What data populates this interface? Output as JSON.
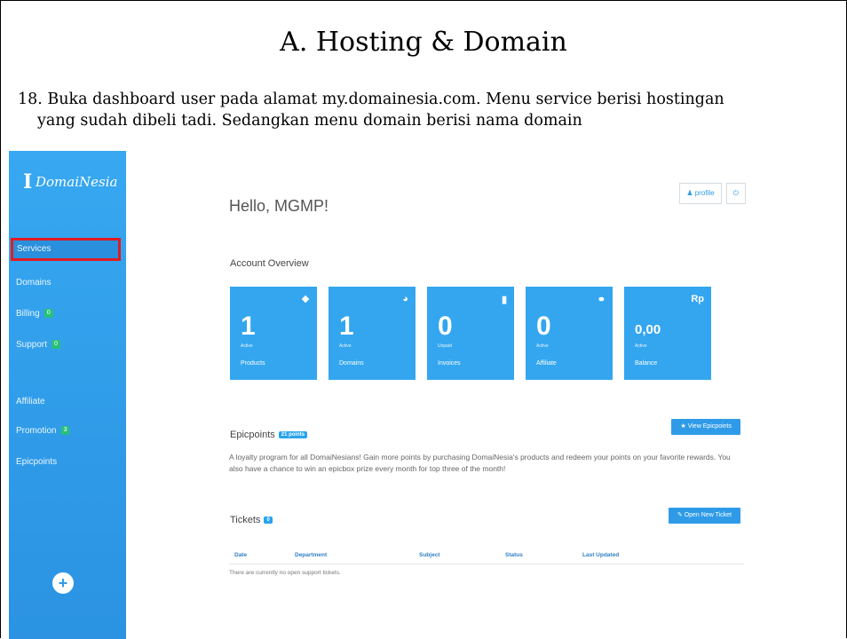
{
  "slide": {
    "title": "A. Hosting & Domain",
    "paragraph_line1": "18. Buka dashboard user pada alamat my.domainesia.com. Menu service berisi hostingan",
    "paragraph_line2": "yang sudah dibeli tadi. Sedangkan menu domain berisi nama domain"
  },
  "logo": {
    "text": "DomaiNesia",
    "mark": "I"
  },
  "sidebar": {
    "items": [
      {
        "label": "Services",
        "active": true
      },
      {
        "label": "Domains"
      },
      {
        "label": "Billing",
        "badge": "0"
      },
      {
        "label": "Support",
        "badge": "0"
      },
      {
        "label": "Affiliate"
      },
      {
        "label": "Promotion",
        "badge": "3"
      },
      {
        "label": "Epicpoints"
      }
    ],
    "add_label": "+"
  },
  "header": {
    "profile_label": "profile",
    "profile_icon": "user-icon",
    "power_icon": "power-icon",
    "power_glyph": "⏻",
    "greeting": "Hello, MGMP!"
  },
  "overview": {
    "heading": "Account Overview",
    "cards": [
      {
        "value": "1",
        "sub": "Active",
        "caption": "Products",
        "icon": "stack-icon",
        "glyph": "❖"
      },
      {
        "value": "1",
        "sub": "Active",
        "caption": "Domains",
        "icon": "globe-icon",
        "glyph": "◕"
      },
      {
        "value": "0",
        "sub": "Unpaid",
        "caption": "Invoices",
        "icon": "file-icon",
        "glyph": "▮"
      },
      {
        "value": "0",
        "sub": "Active",
        "caption": "Affiliate",
        "icon": "link-icon",
        "glyph": "⚭"
      },
      {
        "value": "0,00",
        "sub": "Active",
        "caption": "Balance",
        "icon": "rupiah-icon",
        "glyph": "Rp"
      }
    ]
  },
  "epicpoints": {
    "heading": "Epicpoints",
    "badge": "21 points",
    "button": "View Epicpoints",
    "description": "A loyalty program for all DomaiNesians! Gain more points by purchasing DomaiNesia's products and redeem your points on your favorite rewards. You also have a chance to win an epicbox prize every month for top three of the month!"
  },
  "tickets": {
    "heading": "Tickets",
    "badge": "0",
    "button": "Open New Ticket",
    "columns": [
      "Date",
      "Department",
      "Subject",
      "Status",
      "Last Updated"
    ],
    "empty_text": "There are currently no open support tickets."
  },
  "colors": {
    "sidebar": "#2f9be8",
    "card": "#33a6ef",
    "highlight": "#e11b22",
    "badge": "#27c07a"
  }
}
